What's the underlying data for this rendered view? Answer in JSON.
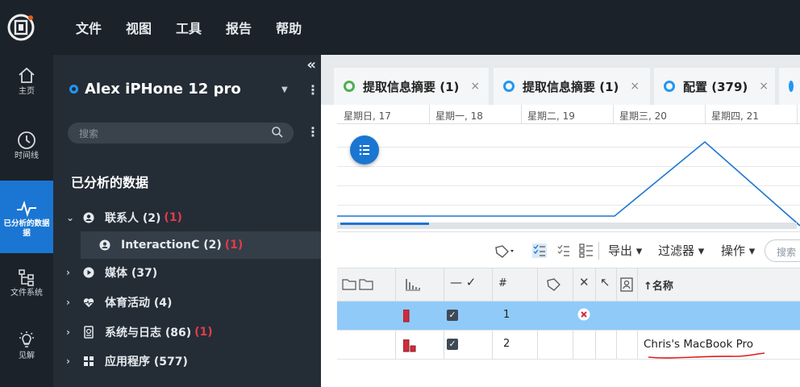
{
  "menu": [
    "文件",
    "视图",
    "工具",
    "报告",
    "帮助"
  ],
  "rail": [
    {
      "label": "主页",
      "icon": "home-icon"
    },
    {
      "label": "时间线",
      "icon": "clock-icon"
    },
    {
      "label": "已分析的数据",
      "label_line2": "据",
      "icon": "pulse-icon",
      "active": true
    },
    {
      "label": "文件系统",
      "icon": "file-system-icon"
    },
    {
      "label": "见解",
      "icon": "bulb-icon"
    }
  ],
  "panel": {
    "collapse": "«",
    "device_name": "Alex iPHone 12 pro",
    "search_placeholder": "搜索",
    "section_title": "已分析的数据",
    "tree": [
      {
        "label": "联系人 (2)",
        "red": "(1)",
        "chev": "⌄",
        "icon": "person-icon"
      },
      {
        "label": "InteractionC (2)",
        "red": "(1)",
        "icon": "person-icon",
        "child": true
      },
      {
        "label": "媒体 (37)",
        "red": "",
        "chev": "›",
        "icon": "media-icon"
      },
      {
        "label": "体育活动 (4)",
        "red": "",
        "chev": "›",
        "icon": "heart-icon"
      },
      {
        "label": "系统与日志 (86)",
        "red": "(1)",
        "chev": "›",
        "icon": "log-icon"
      },
      {
        "label": "应用程序 (577)",
        "red": "",
        "chev": "›",
        "icon": "apps-icon"
      }
    ]
  },
  "tabs": [
    {
      "label": "提取信息摘要 (1)",
      "close": "×",
      "color": "#4caf50"
    },
    {
      "label": "提取信息摘要 (1)",
      "close": "×",
      "color": "#2196f3"
    },
    {
      "label": "配置 (379)",
      "close": "×",
      "color": "#2196f3"
    }
  ],
  "timeline": {
    "days": [
      "星期日, 17",
      "星期一, 18",
      "星期二, 19",
      "星期三, 20",
      "星期四, 21"
    ]
  },
  "toolbar": {
    "export": "导出 ▾",
    "filter": "过滤器 ▾",
    "action": "操作 ▾",
    "search_placeholder": "搜索"
  },
  "table": {
    "headers": {
      "num": "#",
      "name": "↑名称"
    },
    "rows": [
      {
        "num": "1",
        "name": "",
        "selected": true,
        "error": true
      },
      {
        "num": "2",
        "name": "Chris's MacBook Pro",
        "selected": false,
        "error": false
      }
    ]
  },
  "colors": {
    "accent": "#1a76d2",
    "red": "#e33b4a",
    "selected_row": "#90caf9"
  }
}
